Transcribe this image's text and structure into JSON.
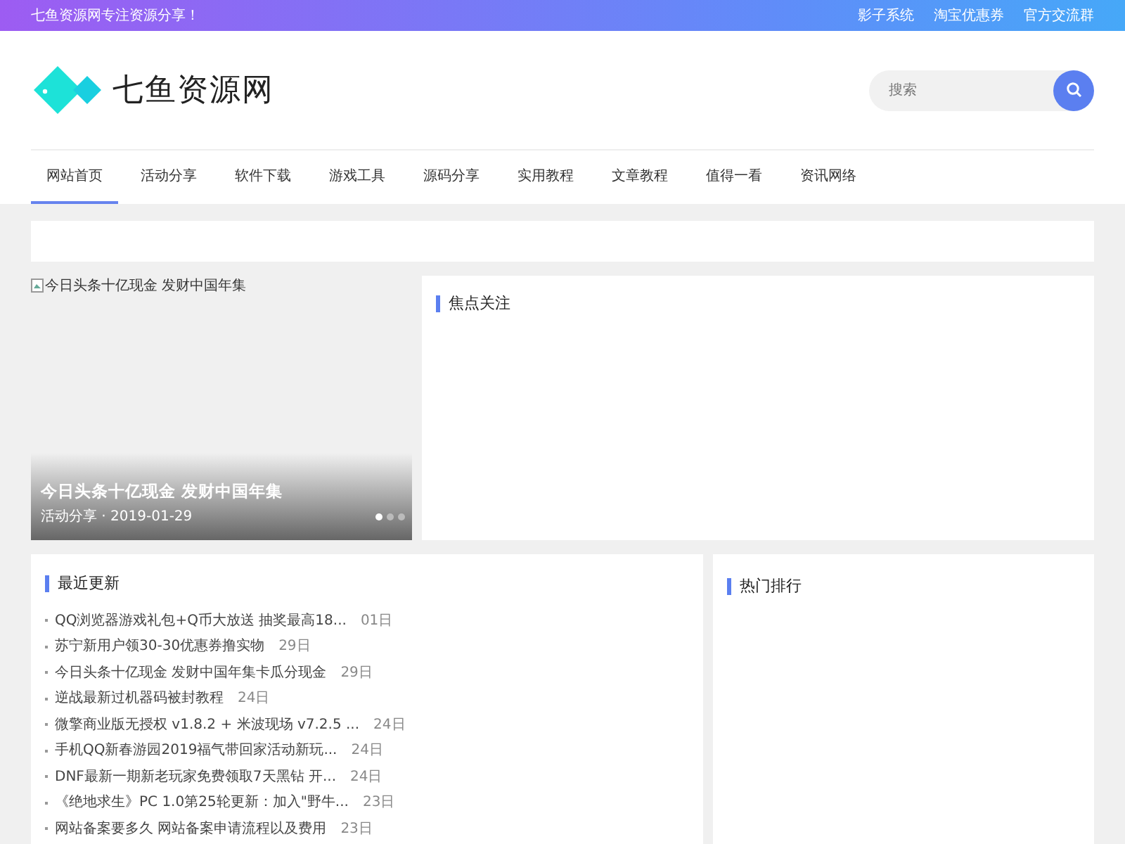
{
  "top_bar": {
    "slogan": "七鱼资源网专注资源分享！",
    "links": [
      "影子系统",
      "淘宝优惠券",
      "官方交流群"
    ]
  },
  "header": {
    "site_name": "七鱼资源网",
    "search": {
      "placeholder": "搜索"
    }
  },
  "nav": [
    {
      "label": "网站首页",
      "selected": true
    },
    {
      "label": "活动分享",
      "selected": false
    },
    {
      "label": "软件下载",
      "selected": false
    },
    {
      "label": "游戏工具",
      "selected": false
    },
    {
      "label": "源码分享",
      "selected": false
    },
    {
      "label": "实用教程",
      "selected": false
    },
    {
      "label": "文章教程",
      "selected": false
    },
    {
      "label": "值得一看",
      "selected": false
    },
    {
      "label": "资讯网络",
      "selected": false
    }
  ],
  "slider": {
    "image_alt": "今日头条十亿现金 发财中国年集",
    "title": "今日头条十亿现金 发财中国年集",
    "meta": "活动分享 · 2019-01-29",
    "dots": [
      {
        "selected": true
      },
      {
        "selected": false
      },
      {
        "selected": false
      }
    ]
  },
  "focus": {
    "title": "焦点关注"
  },
  "recent": {
    "title": "最近更新",
    "items": [
      {
        "title": "QQ浏览器游戏礼包+Q币大放送 抽奖最高18...",
        "date": "01日"
      },
      {
        "title": "苏宁新用户领30-30优惠券撸实物",
        "date": "29日"
      },
      {
        "title": "今日头条十亿现金 发财中国年集卡瓜分现金",
        "date": "29日"
      },
      {
        "title": "逆战最新过机器码被封教程",
        "date": "24日"
      },
      {
        "title": "微擎商业版无授权 v1.8.2 + 米波现场 v7.2.5 ...",
        "date": "24日"
      },
      {
        "title": "手机QQ新春游园2019福气带回家活动新玩...",
        "date": "24日"
      },
      {
        "title": "DNF最新一期新老玩家免费领取7天黑钻 开...",
        "date": "24日"
      },
      {
        "title": "《绝地求生》PC 1.0第25轮更新：加入\"野牛...",
        "date": "23日"
      },
      {
        "title": "网站备案要多久 网站备案申请流程以及费用",
        "date": "23日"
      }
    ]
  },
  "hot": {
    "title": "热门排行"
  }
}
